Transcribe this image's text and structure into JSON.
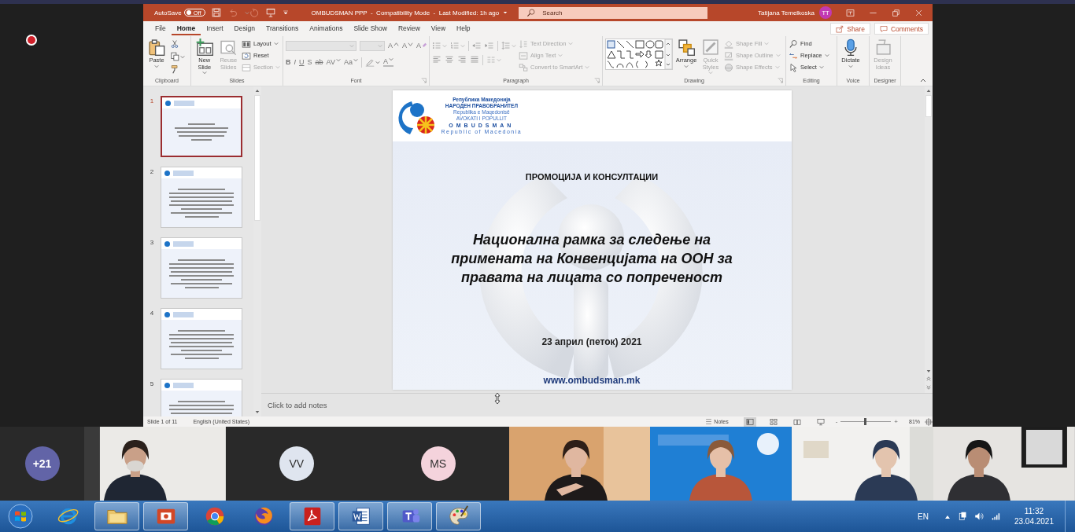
{
  "title_bar": {
    "autosave_label": "AutoSave",
    "autosave_toggle": {
      "label": "Off",
      "on": false
    },
    "document_title": "OMBUDSMAN PPP  -  Compatibility Mode  -  Last Modified: 1h ago",
    "search": {
      "placeholder": "Search"
    },
    "user_name": "Tatijana Temelkoska",
    "user_initials": "TT"
  },
  "menu_tabs": [
    {
      "label": "File",
      "selected": false
    },
    {
      "label": "Home",
      "selected": true
    },
    {
      "label": "Insert",
      "selected": false
    },
    {
      "label": "Design",
      "selected": false
    },
    {
      "label": "Transitions",
      "selected": false
    },
    {
      "label": "Animations",
      "selected": false
    },
    {
      "label": "Slide Show",
      "selected": false
    },
    {
      "label": "Review",
      "selected": false
    },
    {
      "label": "View",
      "selected": false
    },
    {
      "label": "Help",
      "selected": false
    }
  ],
  "share_button": "Share",
  "comments_button": "Comments",
  "ribbon": {
    "groups": [
      {
        "label": "Clipboard",
        "items": [
          {
            "label": "Paste",
            "disabled": false,
            "menu": true
          }
        ]
      },
      {
        "label": "Slides",
        "items": [
          {
            "label": "New Slide",
            "disabled": false,
            "menu": true
          },
          {
            "label": "Reuse Slides",
            "disabled": true,
            "menu": false
          },
          {
            "label": "Layout",
            "disabled": false,
            "menu": true
          },
          {
            "label": "Reset",
            "disabled": false,
            "menu": false
          },
          {
            "label": "Section",
            "disabled": true,
            "menu": true
          }
        ]
      },
      {
        "label": "Font",
        "rows": [
          [
            {
              "label": "A",
              "menu": false
            },
            {
              "label": "A",
              "menu": false
            },
            {
              "label": "A",
              "menu": false
            }
          ],
          [
            {
              "label": "B",
              "menu": false
            },
            {
              "label": "I",
              "menu": false
            },
            {
              "label": "U",
              "menu": false
            },
            {
              "label": "S",
              "menu": false
            },
            {
              "label": "ab",
              "menu": false
            },
            {
              "label": "AV",
              "menu": true
            },
            {
              "label": "Aa",
              "menu": true
            },
            {
              "label": "A",
              "menu": true
            }
          ]
        ]
      },
      {
        "label": "Paragraph",
        "items": [
          {
            "label": "Text Direction",
            "disabled": true,
            "menu": true
          },
          {
            "label": "Align Text",
            "disabled": true,
            "menu": true
          },
          {
            "label": "Convert to SmartArt",
            "disabled": true,
            "menu": true
          }
        ]
      },
      {
        "label": "Drawing",
        "items": [
          {
            "label": "Arrange",
            "disabled": false,
            "menu": true
          },
          {
            "label": "Quick Styles",
            "disabled": true,
            "menu": true
          },
          {
            "label": "Shape Fill",
            "disabled": true,
            "menu": true
          },
          {
            "label": "Shape Outline",
            "disabled": true,
            "menu": true
          },
          {
            "label": "Shape Effects",
            "disabled": true,
            "menu": true
          }
        ]
      },
      {
        "label": "Editing",
        "items": [
          {
            "label": "Find",
            "disabled": false,
            "menu": false
          },
          {
            "label": "Replace",
            "disabled": false,
            "menu": true
          },
          {
            "label": "Select",
            "disabled": false,
            "menu": true
          }
        ]
      },
      {
        "label": "Voice",
        "items": [
          {
            "label": "Dictate",
            "disabled": false,
            "menu": true
          }
        ]
      },
      {
        "label": "Designer",
        "items": [
          {
            "label": "Design Ideas",
            "disabled": true,
            "menu": false
          }
        ]
      }
    ]
  },
  "slides_panel": {
    "slides": [
      {
        "number": "1",
        "selected": true
      },
      {
        "number": "2",
        "selected": false
      },
      {
        "number": "3",
        "selected": false
      },
      {
        "number": "4",
        "selected": false
      },
      {
        "number": "5",
        "selected": false
      }
    ]
  },
  "slide": {
    "logo_lines": [
      "Република Македонија",
      "НАРОДЕН ПРАВОБРАНИТЕЛ",
      "Republika e Maqedonisë",
      "AVOKATI I POPULLIT",
      "OMBUDSMAN",
      "Republic of Macedonia"
    ],
    "heading": "ПРОМОЦИЈА И КОНСУЛТАЦИИ",
    "title": "Национална рамка за следење на примената на Конвенцијата на ООН за правата на лицата со попреченост",
    "date": "23 април (петок) 2021",
    "website": "www.ombudsman.mk"
  },
  "notes_placeholder": "Click to add notes",
  "status_bar": {
    "slide_position": "Slide 1 of 11",
    "language": "English (United States)",
    "notes_button": "Notes",
    "views": [
      {
        "selected": true
      },
      {
        "selected": false
      },
      {
        "selected": false
      },
      {
        "selected": false
      }
    ],
    "zoom": {
      "minus": "-",
      "plus": "+",
      "level": 0.48,
      "reading": "81%"
    }
  },
  "participants": [
    {
      "kind": "overflow",
      "label": "+21",
      "color": "#6264a7"
    },
    {
      "kind": "picture"
    },
    {
      "kind": "avatar",
      "label": "VV",
      "color": "#dfe5ef"
    },
    {
      "kind": "avatar",
      "label": "MS",
      "color": "#f4d3dc"
    },
    {
      "kind": "picture"
    },
    {
      "kind": "picture"
    },
    {
      "kind": "picture"
    },
    {
      "kind": "picture"
    }
  ],
  "taskbar": {
    "apps": [
      {
        "open": false
      },
      {
        "open": true
      },
      {
        "open": true
      },
      {
        "open": false
      },
      {
        "open": false
      },
      {
        "open": true
      },
      {
        "open": true
      },
      {
        "open": true
      },
      {
        "open": true
      }
    ],
    "language": "EN",
    "time": "11:32",
    "date": "23.04.2021"
  }
}
